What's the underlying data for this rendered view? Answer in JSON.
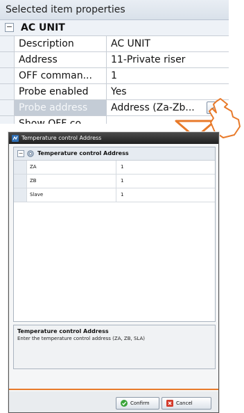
{
  "properties": {
    "title": "Selected item properties",
    "category": "AC UNIT",
    "category_toggle": "−",
    "rows": [
      {
        "name": "Description",
        "value": "AC UNIT"
      },
      {
        "name": "Address",
        "value": "11-Private riser"
      },
      {
        "name": "OFF comman...",
        "value": "1"
      },
      {
        "name": "Probe enabled",
        "value": "Yes"
      },
      {
        "name": "Probe address",
        "value": "Address (Za-Zb..."
      },
      {
        "name": "Show OFF co...",
        "value": ""
      }
    ],
    "ellipsis_label": "...",
    "accent_color": "#e87a2a"
  },
  "dialog": {
    "title": "Temperature control Address",
    "category": "Temperature control Address",
    "category_toggle": "−",
    "rows": [
      {
        "name": "ZA",
        "value": "1"
      },
      {
        "name": "ZB",
        "value": "1"
      },
      {
        "name": "Slave",
        "value": "1"
      }
    ],
    "description": {
      "title": "Temperature control Address",
      "text": "Enter the temperature control address (ZA, ZB, SLA)"
    },
    "buttons": {
      "confirm": "Confirm",
      "cancel": "Cancel"
    },
    "icons": {
      "title": "app-icon",
      "category": "gear-icon",
      "confirm": "check-icon",
      "cancel": "close-icon"
    }
  }
}
